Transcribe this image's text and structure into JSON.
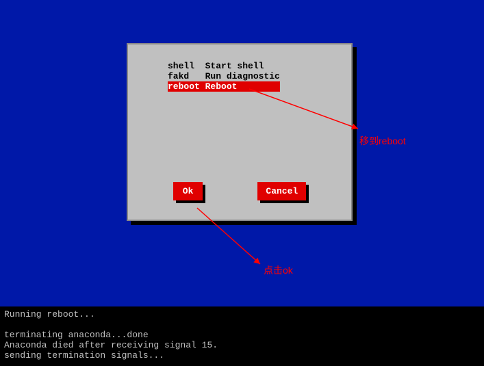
{
  "menu": {
    "items": [
      {
        "cmd": "shell ",
        "desc": " Start shell",
        "selected": false
      },
      {
        "cmd": "fakd  ",
        "desc": " Run diagnostic",
        "selected": false
      },
      {
        "cmd": "reboot",
        "desc": " Reboot",
        "selected": true
      }
    ]
  },
  "buttons": {
    "ok": "Ok",
    "cancel": "Cancel"
  },
  "annotations": {
    "reboot_hint": "移到reboot",
    "ok_hint": "点击ok"
  },
  "terminal": {
    "line1": "Running reboot...",
    "line2": "",
    "line3": "terminating anaconda...done",
    "line4": "Anaconda died after receiving signal 15.",
    "line5": "sending termination signals..."
  }
}
